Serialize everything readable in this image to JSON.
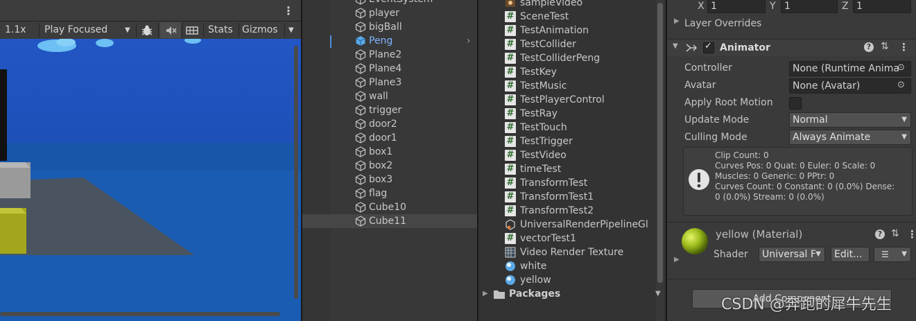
{
  "game": {
    "scale": "1.1x",
    "play_mode": "Play Focused",
    "stats_label": "Stats",
    "gizmos_label": "Gizmos"
  },
  "hierarchy": {
    "items": [
      {
        "name": "EventSystem"
      },
      {
        "name": "player"
      },
      {
        "name": "bigBall"
      },
      {
        "name": "Peng"
      },
      {
        "name": "Plane2"
      },
      {
        "name": "Plane4"
      },
      {
        "name": "Plane3"
      },
      {
        "name": "wall"
      },
      {
        "name": "trigger"
      },
      {
        "name": "door2"
      },
      {
        "name": "door1"
      },
      {
        "name": "box1"
      },
      {
        "name": "box2"
      },
      {
        "name": "box3"
      },
      {
        "name": "flag"
      },
      {
        "name": "Cube10"
      },
      {
        "name": "Cube11"
      }
    ]
  },
  "project": {
    "items": [
      {
        "name": "sampleVideo",
        "icon": "video-clip-icon"
      },
      {
        "name": "SceneTest",
        "icon": "script-icon"
      },
      {
        "name": "TestAnimation",
        "icon": "script-icon"
      },
      {
        "name": "TestCollider",
        "icon": "script-icon"
      },
      {
        "name": "TestColliderPeng",
        "icon": "script-icon"
      },
      {
        "name": "TestKey",
        "icon": "script-icon"
      },
      {
        "name": "TestMusic",
        "icon": "script-icon"
      },
      {
        "name": "TestPlayerControl",
        "icon": "script-icon"
      },
      {
        "name": "TestRay",
        "icon": "script-icon"
      },
      {
        "name": "TestTouch",
        "icon": "script-icon"
      },
      {
        "name": "TestTrigger",
        "icon": "script-icon"
      },
      {
        "name": "TestVideo",
        "icon": "script-icon"
      },
      {
        "name": "timeTest",
        "icon": "script-icon"
      },
      {
        "name": "TransformTest",
        "icon": "script-icon"
      },
      {
        "name": "TransformTest1",
        "icon": "script-icon"
      },
      {
        "name": "TransformTest2",
        "icon": "script-icon"
      },
      {
        "name": "UniversalRenderPipelineGl",
        "icon": "render-pipeline-icon"
      },
      {
        "name": "vectorTest1",
        "icon": "script-icon"
      },
      {
        "name": "Video Render Texture",
        "icon": "render-texture-icon"
      },
      {
        "name": "white",
        "icon": "material-icon"
      },
      {
        "name": "yellow",
        "icon": "material-icon"
      }
    ],
    "packages_label": "Packages"
  },
  "inspector": {
    "scale": {
      "x_label": "X",
      "x": "1",
      "y_label": "Y",
      "y": "1",
      "z_label": "Z",
      "z": "1"
    },
    "layer_overrides": "Layer Overrides",
    "animator": {
      "title": "Animator",
      "controller_label": "Controller",
      "controller_value": "None (Runtime Anima",
      "avatar_label": "Avatar",
      "avatar_value": "None (Avatar)",
      "apply_root_motion_label": "Apply Root Motion",
      "update_mode_label": "Update Mode",
      "update_mode_value": "Normal",
      "culling_mode_label": "Culling Mode",
      "culling_mode_value": "Always Animate",
      "info": [
        "Clip Count: 0",
        "Curves Pos: 0 Quat: 0 Euler: 0 Scale: 0",
        "Muscles: 0 Generic: 0 PPtr: 0",
        "Curves Count: 0 Constant: 0 (0.0%) Dense:",
        "0 (0.0%) Stream: 0 (0.0%)"
      ]
    },
    "material": {
      "title": "yellow (Material)",
      "shader_label": "Shader",
      "shader_value": "Universal F",
      "edit_label": "Edit..."
    },
    "add_component": "Add Component"
  },
  "watermark": "CSDN @奔跑的犀牛先生"
}
